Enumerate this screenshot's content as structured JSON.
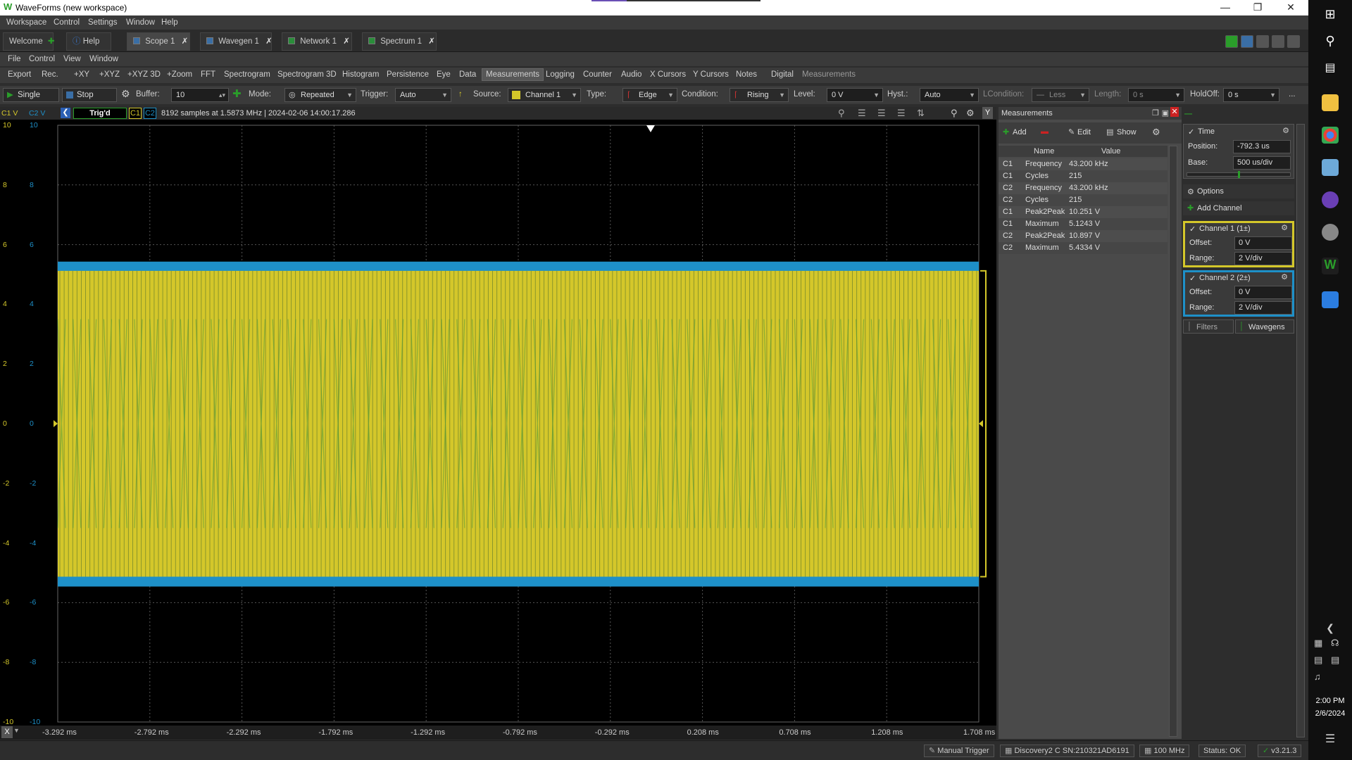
{
  "window": {
    "title": "WaveForms (new workspace)"
  },
  "menu": [
    "Workspace",
    "Control",
    "Settings",
    "Window",
    "Help"
  ],
  "tabs": [
    {
      "label": "Welcome",
      "color": "#2a9d2a"
    },
    {
      "label": "Help",
      "color": "#3a7bd5"
    },
    {
      "label": "Scope 1",
      "color": "#3a6ea5"
    },
    {
      "label": "Wavegen 1",
      "color": "#3a6ea5"
    },
    {
      "label": "Network 1",
      "color": "#2a8d3a"
    },
    {
      "label": "Spectrum 1",
      "color": "#2a8d3a"
    }
  ],
  "submenu": [
    "File",
    "Control",
    "View",
    "Window"
  ],
  "instrument_menu": [
    "Export",
    "Rec.",
    "+XY",
    "+XYZ",
    "+XYZ 3D",
    "+Zoom",
    "FFT",
    "Spectrogram",
    "Spectrogram 3D",
    "Histogram",
    "Persistence",
    "Eye",
    "Data",
    "Measurements",
    "Logging",
    "Counter",
    "Audio",
    "X Cursors",
    "Y Cursors",
    "Notes",
    "Digital",
    "Measurements"
  ],
  "controls": {
    "single": "Single",
    "stop": "Stop",
    "buffer_label": "Buffer:",
    "buffer_value": "10",
    "mode_label": "Mode:",
    "mode_value": "Repeated",
    "trigger_label": "Trigger:",
    "trigger_value": "Auto",
    "source_label": "Source:",
    "source_value": "Channel 1",
    "type_label": "Type:",
    "type_value": "Edge",
    "condition_label": "Condition:",
    "condition_value": "Rising",
    "level_label": "Level:",
    "level_value": "0 V",
    "hyst_label": "Hyst.:",
    "hyst_value": "Auto",
    "lcondition_label": "LCondition:",
    "lcondition_value": "Less",
    "length_label": "Length:",
    "length_value": "0 s",
    "holdoff_label": "HoldOff:",
    "holdoff_value": "0 s",
    "more": "..."
  },
  "infobar": {
    "c1_axis": "C1 V",
    "c2_axis": "C2 V",
    "status": "Trig'd",
    "c1": "C1",
    "c2": "C2",
    "info": "8192 samples at 1.5873 MHz  | 2024-02-06 14:00:17.286"
  },
  "y_ticks": [
    "10",
    "8",
    "6",
    "4",
    "2",
    "0",
    "-2",
    "-4",
    "-6",
    "-8",
    "-10"
  ],
  "x_ticks": [
    "-3.292 ms",
    "-2.792 ms",
    "-2.292 ms",
    "-1.792 ms",
    "-1.292 ms",
    "-0.792 ms",
    "-0.292 ms",
    "0.208 ms",
    "0.708 ms",
    "1.208 ms",
    "1.708 ms"
  ],
  "x_button": "X",
  "y_button": "Y",
  "measurements": {
    "title": "Measurements",
    "add": "Add",
    "edit": "Edit",
    "show": "Show",
    "col_name": "Name",
    "col_value": "Value",
    "rows": [
      {
        "ch": "C1",
        "name": "Frequency",
        "value": "43.200 kHz"
      },
      {
        "ch": "C1",
        "name": "Cycles",
        "value": "215"
      },
      {
        "ch": "C2",
        "name": "Frequency",
        "value": "43.200 kHz"
      },
      {
        "ch": "C2",
        "name": "Cycles",
        "value": "215"
      },
      {
        "ch": "C1",
        "name": "Peak2Peak",
        "value": "10.251 V"
      },
      {
        "ch": "C1",
        "name": "Maximum",
        "value": "5.1243 V"
      },
      {
        "ch": "C2",
        "name": "Peak2Peak",
        "value": "10.897 V"
      },
      {
        "ch": "C2",
        "name": "Maximum",
        "value": "5.4334 V"
      }
    ]
  },
  "side": {
    "time_title": "Time",
    "position_label": "Position:",
    "position_value": "-792.3 us",
    "base_label": "Base:",
    "base_value": "500 us/div",
    "options": "Options",
    "add_channel": "Add Channel",
    "ch1_title": "Channel 1 (1±)",
    "ch1_offset_label": "Offset:",
    "ch1_offset": "0 V",
    "ch1_range_label": "Range:",
    "ch1_range": "2 V/div",
    "ch2_title": "Channel 2 (2±)",
    "ch2_offset_label": "Offset:",
    "ch2_offset": "0 V",
    "ch2_range_label": "Range:",
    "ch2_range": "2 V/div",
    "filters": "Filters",
    "wavegens": "Wavegens"
  },
  "statusbar": {
    "manual_trigger": "Manual Trigger",
    "device": "Discovery2 C SN:210321AD6191",
    "clock": "100 MHz",
    "status": "Status: OK",
    "version": "v3.21.3"
  },
  "clock": {
    "time": "2:00 PM",
    "date": "2/6/2024"
  },
  "colors": {
    "ch1": "#d4c72a",
    "ch2": "#1e90c8",
    "accent": "#2a9d2a"
  }
}
